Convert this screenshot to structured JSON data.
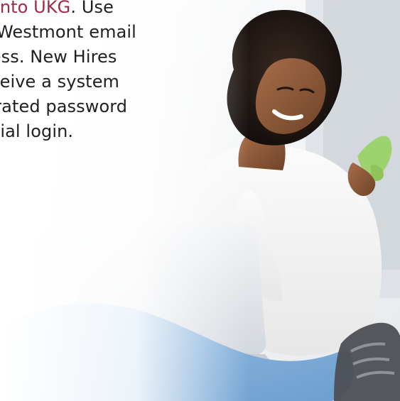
{
  "text": {
    "link_text": "g onto UKG",
    "line1_rest": ". Use",
    "line2": "ur Westmont email",
    "line3": "dress. New Hires",
    "line4": "receive a system",
    "line5": "nerated password",
    "line6": "initial login."
  },
  "colors": {
    "link": "#9e2a4a",
    "text": "#1f1f1f",
    "background": "#f3f4f6"
  },
  "image": {
    "subject": "woman-using-laptop"
  }
}
